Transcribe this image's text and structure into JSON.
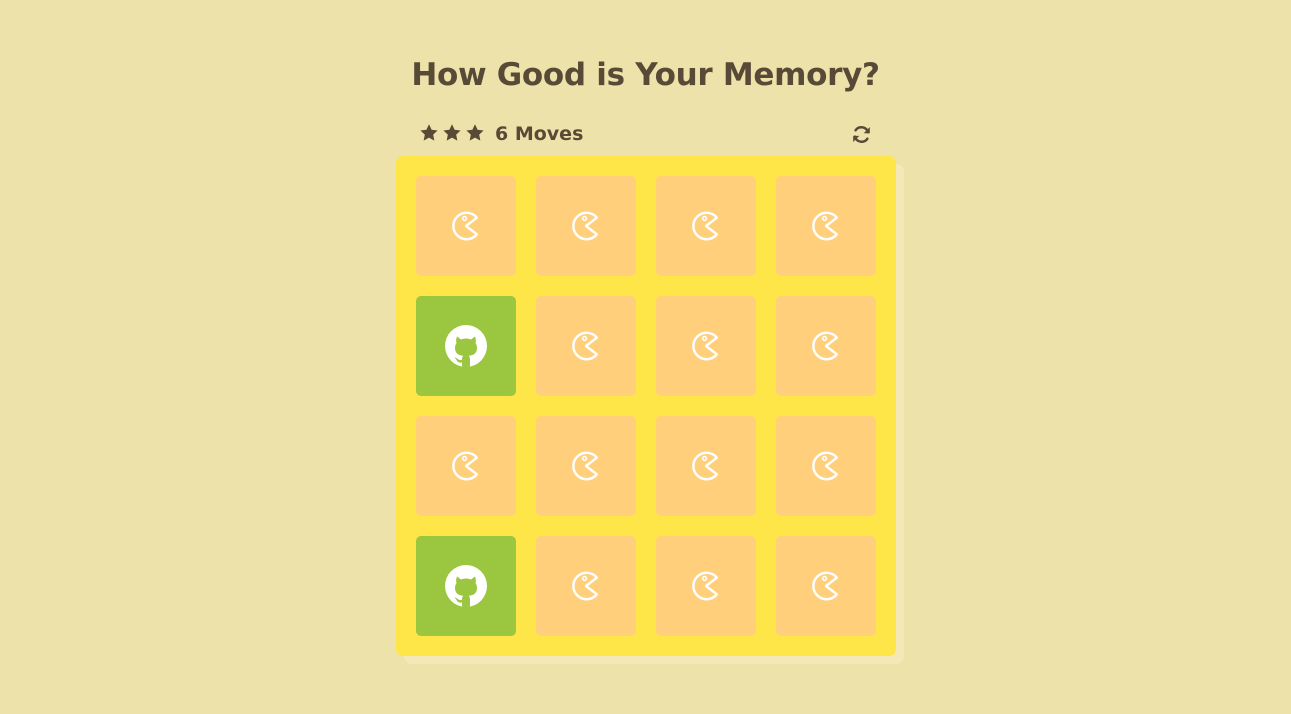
{
  "header": {
    "title": "How Good is Your Memory?"
  },
  "score_panel": {
    "stars": [
      "star-icon",
      "star-icon",
      "star-icon"
    ],
    "moves_text": "6 Moves",
    "restart_icon": "refresh-icon"
  },
  "colors": {
    "background": "#ede2a9",
    "deck": "#ffe648",
    "card_back": "#ffcf7c",
    "card_match": "#9bc640",
    "text": "#574a37"
  },
  "deck": {
    "columns": 4,
    "cards": [
      {
        "state": "hidden",
        "icon": "pacman-icon"
      },
      {
        "state": "hidden",
        "icon": "pacman-icon"
      },
      {
        "state": "hidden",
        "icon": "pacman-icon"
      },
      {
        "state": "hidden",
        "icon": "pacman-icon"
      },
      {
        "state": "match",
        "icon": "github-icon"
      },
      {
        "state": "hidden",
        "icon": "pacman-icon"
      },
      {
        "state": "hidden",
        "icon": "pacman-icon"
      },
      {
        "state": "hidden",
        "icon": "pacman-icon"
      },
      {
        "state": "hidden",
        "icon": "pacman-icon"
      },
      {
        "state": "hidden",
        "icon": "pacman-icon"
      },
      {
        "state": "hidden",
        "icon": "pacman-icon"
      },
      {
        "state": "hidden",
        "icon": "pacman-icon"
      },
      {
        "state": "match",
        "icon": "github-icon"
      },
      {
        "state": "hidden",
        "icon": "pacman-icon"
      },
      {
        "state": "hidden",
        "icon": "pacman-icon"
      },
      {
        "state": "hidden",
        "icon": "pacman-icon"
      }
    ]
  }
}
